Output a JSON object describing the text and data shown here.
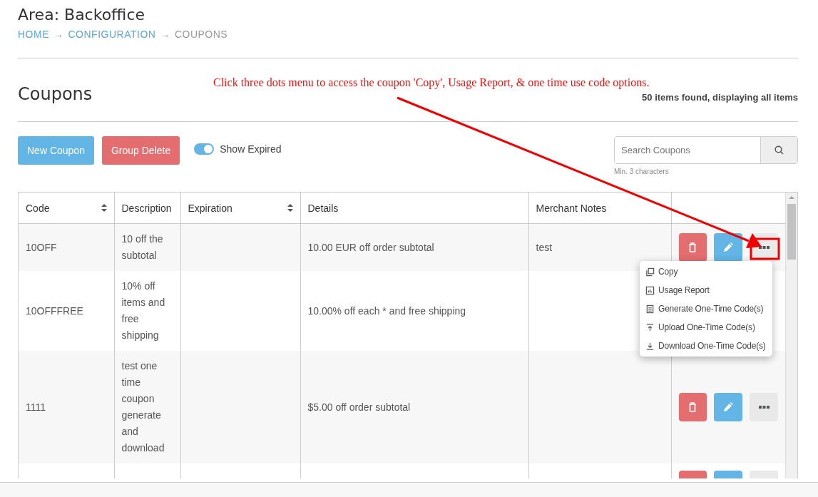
{
  "area_title": "Area: Backoffice",
  "breadcrumb": [
    {
      "label": "HOME",
      "kind": "link"
    },
    {
      "label": "→",
      "kind": "separator"
    },
    {
      "label": "CONFIGURATION",
      "kind": "link"
    },
    {
      "label": "→",
      "kind": "separator"
    },
    {
      "label": "COUPONS",
      "kind": "current"
    }
  ],
  "page_title": "Coupons",
  "result_count": "50 items found, displaying all items",
  "annotation": {
    "text": "Click three dots menu to access the coupon 'Copy', Usage Report, & one time use code options."
  },
  "toolbar": {
    "buttons": [
      {
        "label": "New Coupon",
        "kind": "primary"
      },
      {
        "label": "Group Delete",
        "kind": "danger"
      }
    ],
    "toggle": {
      "label": "Show Expired",
      "on": true
    },
    "search": {
      "placeholder": "Search Coupons",
      "hint": "Min. 3 characters"
    }
  },
  "table": {
    "columns": [
      {
        "label": "Code",
        "sortable": true
      },
      {
        "label": "Description",
        "sortable": false
      },
      {
        "label": "Expiration",
        "sortable": true
      },
      {
        "label": "Details",
        "sortable": false
      },
      {
        "label": "Merchant Notes",
        "sortable": false
      }
    ],
    "rows": [
      {
        "code": "10OFF",
        "description": "10 off the subtotal",
        "details": "10.00 EUR off order subtotal",
        "merchant_notes": "test",
        "actions": [
          {
            "kind": "delete"
          },
          {
            "kind": "edit"
          },
          {
            "kind": "more"
          }
        ]
      },
      {
        "code": "10OFFFREE",
        "description": "10% off items and free shipping",
        "details": "10.00% off each * and free shipping"
      },
      {
        "code": "1111",
        "description": "test one time coupon generate and download",
        "details": "$5.00 off order subtotal",
        "actions": [
          {
            "kind": "delete"
          },
          {
            "kind": "edit"
          },
          {
            "kind": "more"
          }
        ]
      },
      {
        "actions": [
          {
            "kind": "delete"
          },
          {
            "kind": "edit"
          },
          {
            "kind": "more"
          }
        ]
      }
    ]
  },
  "menu": {
    "items": [
      {
        "label": "Copy"
      },
      {
        "label": "Usage Report"
      },
      {
        "label": "Generate One-Time Code(s)"
      },
      {
        "label": "Upload One-Time Code(s)"
      },
      {
        "label": "Download One-Time Code(s)"
      }
    ]
  }
}
